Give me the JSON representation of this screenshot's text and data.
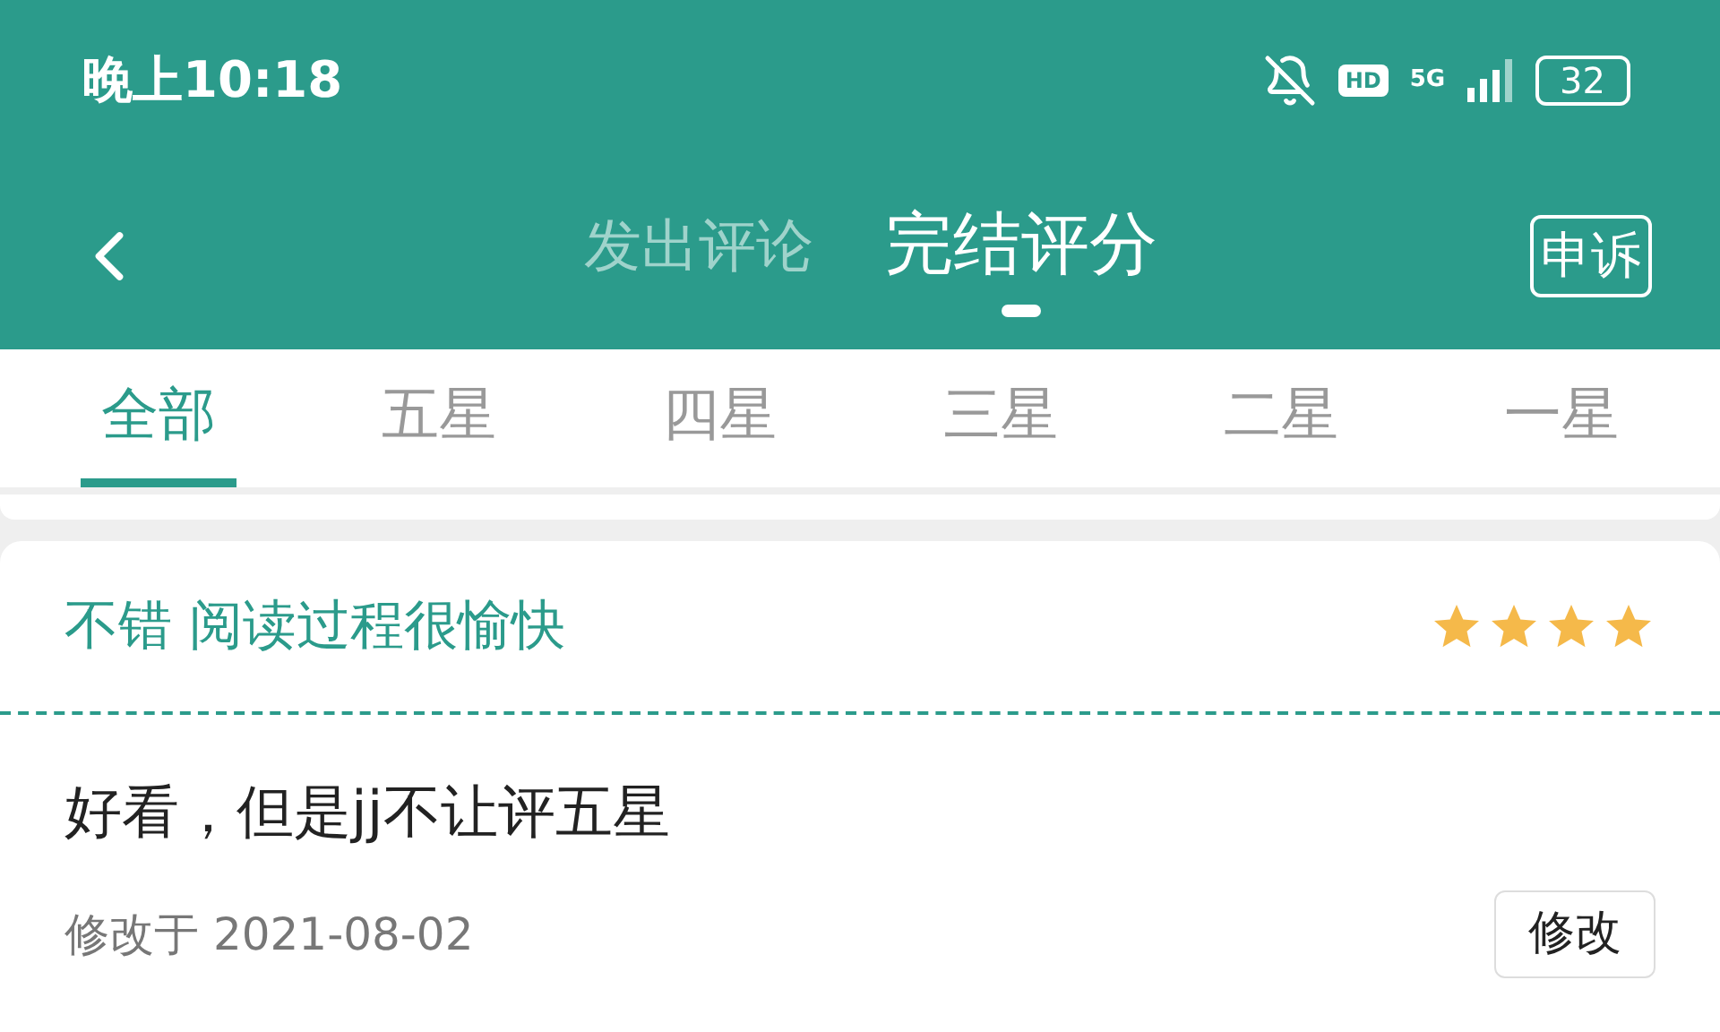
{
  "status_bar": {
    "time": "晚上10:18",
    "hd_badge": "HD",
    "network": "5G",
    "battery": "32"
  },
  "header": {
    "tabs": [
      {
        "label": "发出评论",
        "selected": false
      },
      {
        "label": "完结评分",
        "selected": true
      }
    ],
    "appeal_button": "申诉"
  },
  "filter_tabs": [
    {
      "label": "全部",
      "selected": true
    },
    {
      "label": "五星",
      "selected": false
    },
    {
      "label": "四星",
      "selected": false
    },
    {
      "label": "三星",
      "selected": false
    },
    {
      "label": "二星",
      "selected": false
    },
    {
      "label": "一星",
      "selected": false
    }
  ],
  "review": {
    "title": "不错 阅读过程很愉快",
    "stars": 4,
    "body": "好看，但是jj不让评五星",
    "modified": "修改于 2021-08-02",
    "edit_button": "修改"
  }
}
